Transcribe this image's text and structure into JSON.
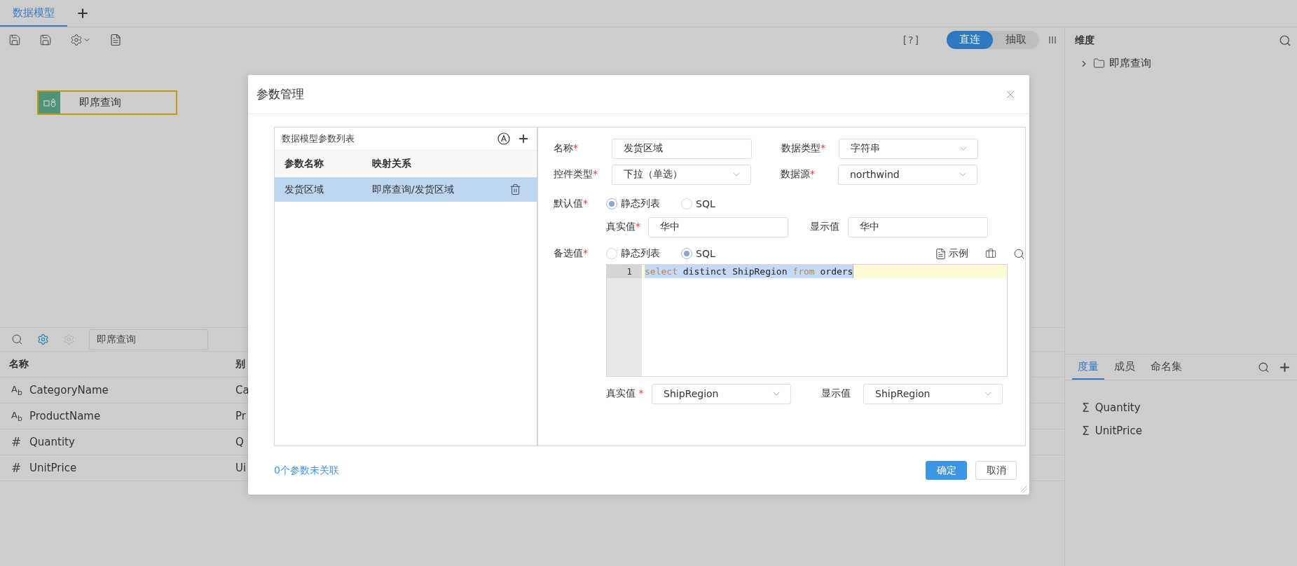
{
  "tabs": [
    {
      "label": "数据模型",
      "selected": true
    }
  ],
  "mode_help": "[?]",
  "mode_toggle": [
    {
      "label": "直连",
      "selected": true
    },
    {
      "label": "抽取",
      "selected": false
    }
  ],
  "canvas": {
    "nodes": [
      {
        "label": "即席查询"
      }
    ]
  },
  "fields_panel": {
    "search_value": "即席查询",
    "columns": [
      "名称",
      "别"
    ],
    "rows": [
      {
        "kind": "text",
        "icon": "A$_{b}$",
        "name": "CategoryName",
        "alias": "Ca"
      },
      {
        "kind": "text",
        "icon": "A$_{b}$",
        "name": "ProductName",
        "alias": "Pr"
      },
      {
        "kind": "number",
        "icon": "#",
        "name": "Quantity",
        "alias": "Q"
      },
      {
        "kind": "number",
        "icon": "#",
        "name": "UnitPrice",
        "alias": "Ui"
      }
    ]
  },
  "dimensions": {
    "title": "维度",
    "tree": [
      {
        "label": "即席查询",
        "expanded": false
      }
    ]
  },
  "measures": {
    "tabs": [
      {
        "label": "度量",
        "selected": true
      },
      {
        "label": "成员",
        "selected": false
      },
      {
        "label": "命名集",
        "selected": false
      }
    ],
    "items": [
      {
        "icon": "Σ",
        "label": "Quantity"
      },
      {
        "icon": "Σ",
        "label": "UnitPrice"
      }
    ]
  },
  "dialog": {
    "title": "参数管理",
    "param_list": {
      "title": "数据模型参数列表",
      "columns": [
        "参数名称",
        "映射关系"
      ],
      "rows": [
        {
          "name": "发货区域",
          "mapping": "即席查询/发货区域",
          "selected": true
        }
      ]
    },
    "form": {
      "name": {
        "label": "名称",
        "required_mark": "*",
        "value": "发货区域"
      },
      "data_type": {
        "label": "数据类型",
        "required_mark": "*",
        "value": "字符串"
      },
      "control_type": {
        "label": "控件类型",
        "required_mark": "*",
        "value": "下拉（单选）"
      },
      "data_source": {
        "label": "数据源",
        "required_mark": "*",
        "value": "northwind"
      },
      "default_value": {
        "label": "默认值",
        "required_mark": "*",
        "options": [
          {
            "label": "静态列表",
            "selected": true
          },
          {
            "label": "SQL",
            "selected": false
          }
        ],
        "real_value": {
          "label": "真实值",
          "required_mark": "*",
          "value": "华中"
        },
        "display_value": {
          "label": "显示值",
          "value": "华中"
        }
      },
      "candidates": {
        "label": "备选值",
        "required_mark": "*",
        "options": [
          {
            "label": "静态列表",
            "selected": false
          },
          {
            "label": "SQL",
            "selected": true
          }
        ],
        "example_label": "示例",
        "editor": {
          "lines": [
            {
              "number": "1",
              "selected": true,
              "tokens": [
                {
                  "kind": "keyword",
                  "text": "select"
                },
                {
                  "kind": "plain",
                  "text": " distinct ShipRegion "
                },
                {
                  "kind": "keyword",
                  "text": "from"
                },
                {
                  "kind": "plain",
                  "text": " orders"
                }
              ]
            }
          ]
        },
        "real_value": {
          "label": "真实值",
          "required_mark": " *",
          "value": "ShipRegion"
        },
        "display_value": {
          "label": "显示值",
          "value": "ShipRegion"
        }
      }
    },
    "unlinked_link": "0个参数未关联",
    "buttons": [
      {
        "label": "确定",
        "kind": "primary"
      },
      {
        "label": "取消",
        "kind": "secondary"
      }
    ]
  }
}
